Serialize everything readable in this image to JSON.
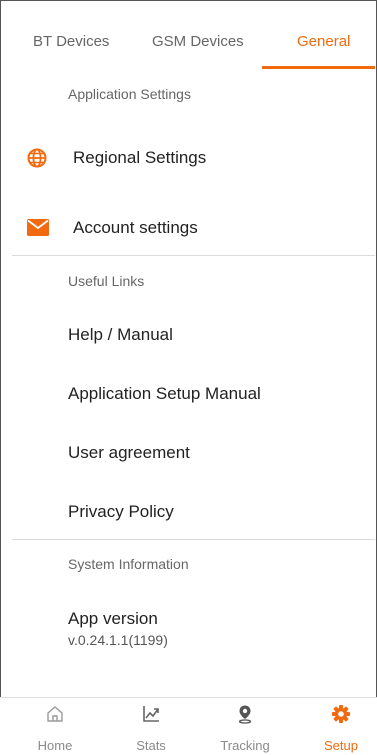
{
  "tabs": [
    {
      "label": "BT Devices",
      "active": false
    },
    {
      "label": "GSM Devices",
      "active": false
    },
    {
      "label": "General",
      "active": true
    }
  ],
  "application_settings": {
    "title": "Application Settings",
    "items": [
      {
        "label": "Regional Settings",
        "icon": "globe-icon"
      },
      {
        "label": "Account settings",
        "icon": "envelope-icon"
      }
    ]
  },
  "useful_links": {
    "title": "Useful Links",
    "items": [
      "Help / Manual",
      "Application Setup Manual",
      "User agreement",
      "Privacy Policy"
    ]
  },
  "system_information": {
    "title": "System Information",
    "app_version_label": "App version",
    "app_version_value": "v.0.24.1.1(1199)"
  },
  "bottom_nav": [
    {
      "label": "Home",
      "icon": "home-icon",
      "active": false
    },
    {
      "label": "Stats",
      "icon": "stats-icon",
      "active": false
    },
    {
      "label": "Tracking",
      "icon": "location-pin-icon",
      "active": false
    },
    {
      "label": "Setup",
      "icon": "gear-icon",
      "active": true
    }
  ],
  "colors": {
    "accent": "#f26a10",
    "text": "#222222",
    "muted": "#666666",
    "divider": "#dcdcdc"
  }
}
